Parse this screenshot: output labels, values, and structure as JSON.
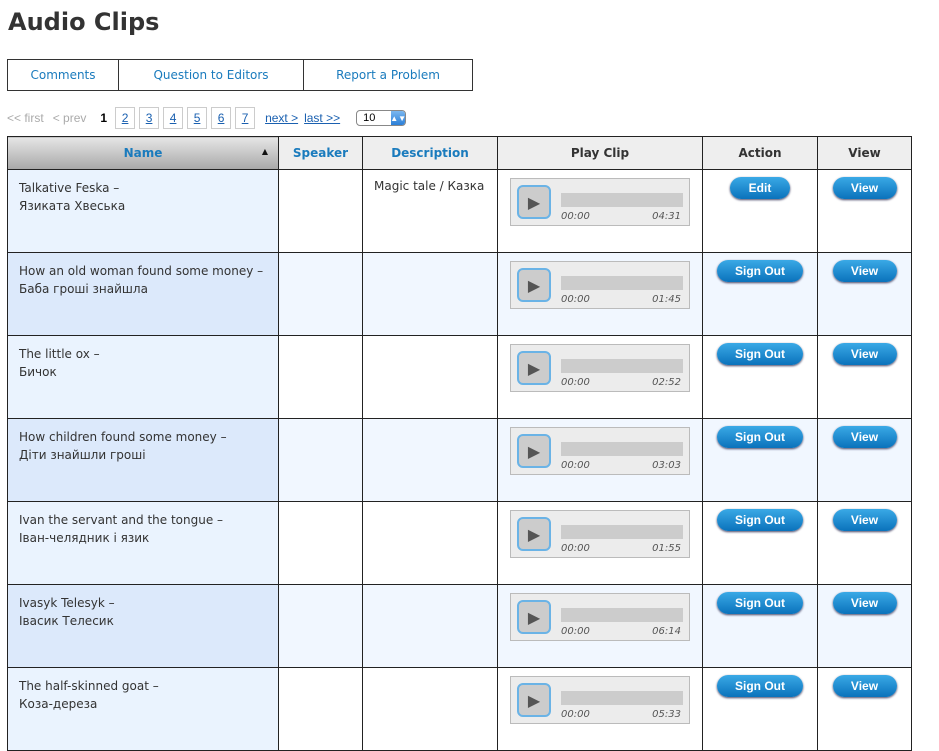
{
  "title": "Audio Clips",
  "tabs": [
    "Comments",
    "Question to Editors",
    "Report a Problem"
  ],
  "pager": {
    "first": "<< first",
    "prev": "< prev",
    "current": "1",
    "pages": [
      "2",
      "3",
      "4",
      "5",
      "6",
      "7"
    ],
    "next": "next >",
    "last": "last >>",
    "per_page": "10"
  },
  "columns": [
    "Name",
    "Speaker",
    "Description",
    "Play Clip",
    "Action",
    "View"
  ],
  "rows": [
    {
      "name_en": "Talkative Feska –",
      "name_uk": "Язиката Хвеська",
      "description": "Magic tale / Казка",
      "start": "00:00",
      "duration": "04:31",
      "action": "Edit",
      "view": "View"
    },
    {
      "name_en": "How an old woman found some money –",
      "name_uk": "Баба гроші знайшла",
      "description": "",
      "start": "00:00",
      "duration": "01:45",
      "action": "Sign Out",
      "view": "View"
    },
    {
      "name_en": "The little ox –",
      "name_uk": "Бичок",
      "description": "",
      "start": "00:00",
      "duration": "02:52",
      "action": "Sign Out",
      "view": "View"
    },
    {
      "name_en": "How children found some money –",
      "name_uk": "Діти знайшли гроші",
      "description": "",
      "start": "00:00",
      "duration": "03:03",
      "action": "Sign Out",
      "view": "View"
    },
    {
      "name_en": "Ivan the servant and the tongue –",
      "name_uk": "Іван-челядник і язик",
      "description": "",
      "start": "00:00",
      "duration": "01:55",
      "action": "Sign Out",
      "view": "View"
    },
    {
      "name_en": "Ivasyk Telesyk –",
      "name_uk": "Івасик Телесик",
      "description": "",
      "start": "00:00",
      "duration": "06:14",
      "action": "Sign Out",
      "view": "View"
    },
    {
      "name_en": "The half-skinned goat –",
      "name_uk": "Коза-дереза",
      "description": "",
      "start": "00:00",
      "duration": "05:33",
      "action": "Sign Out",
      "view": "View"
    }
  ]
}
